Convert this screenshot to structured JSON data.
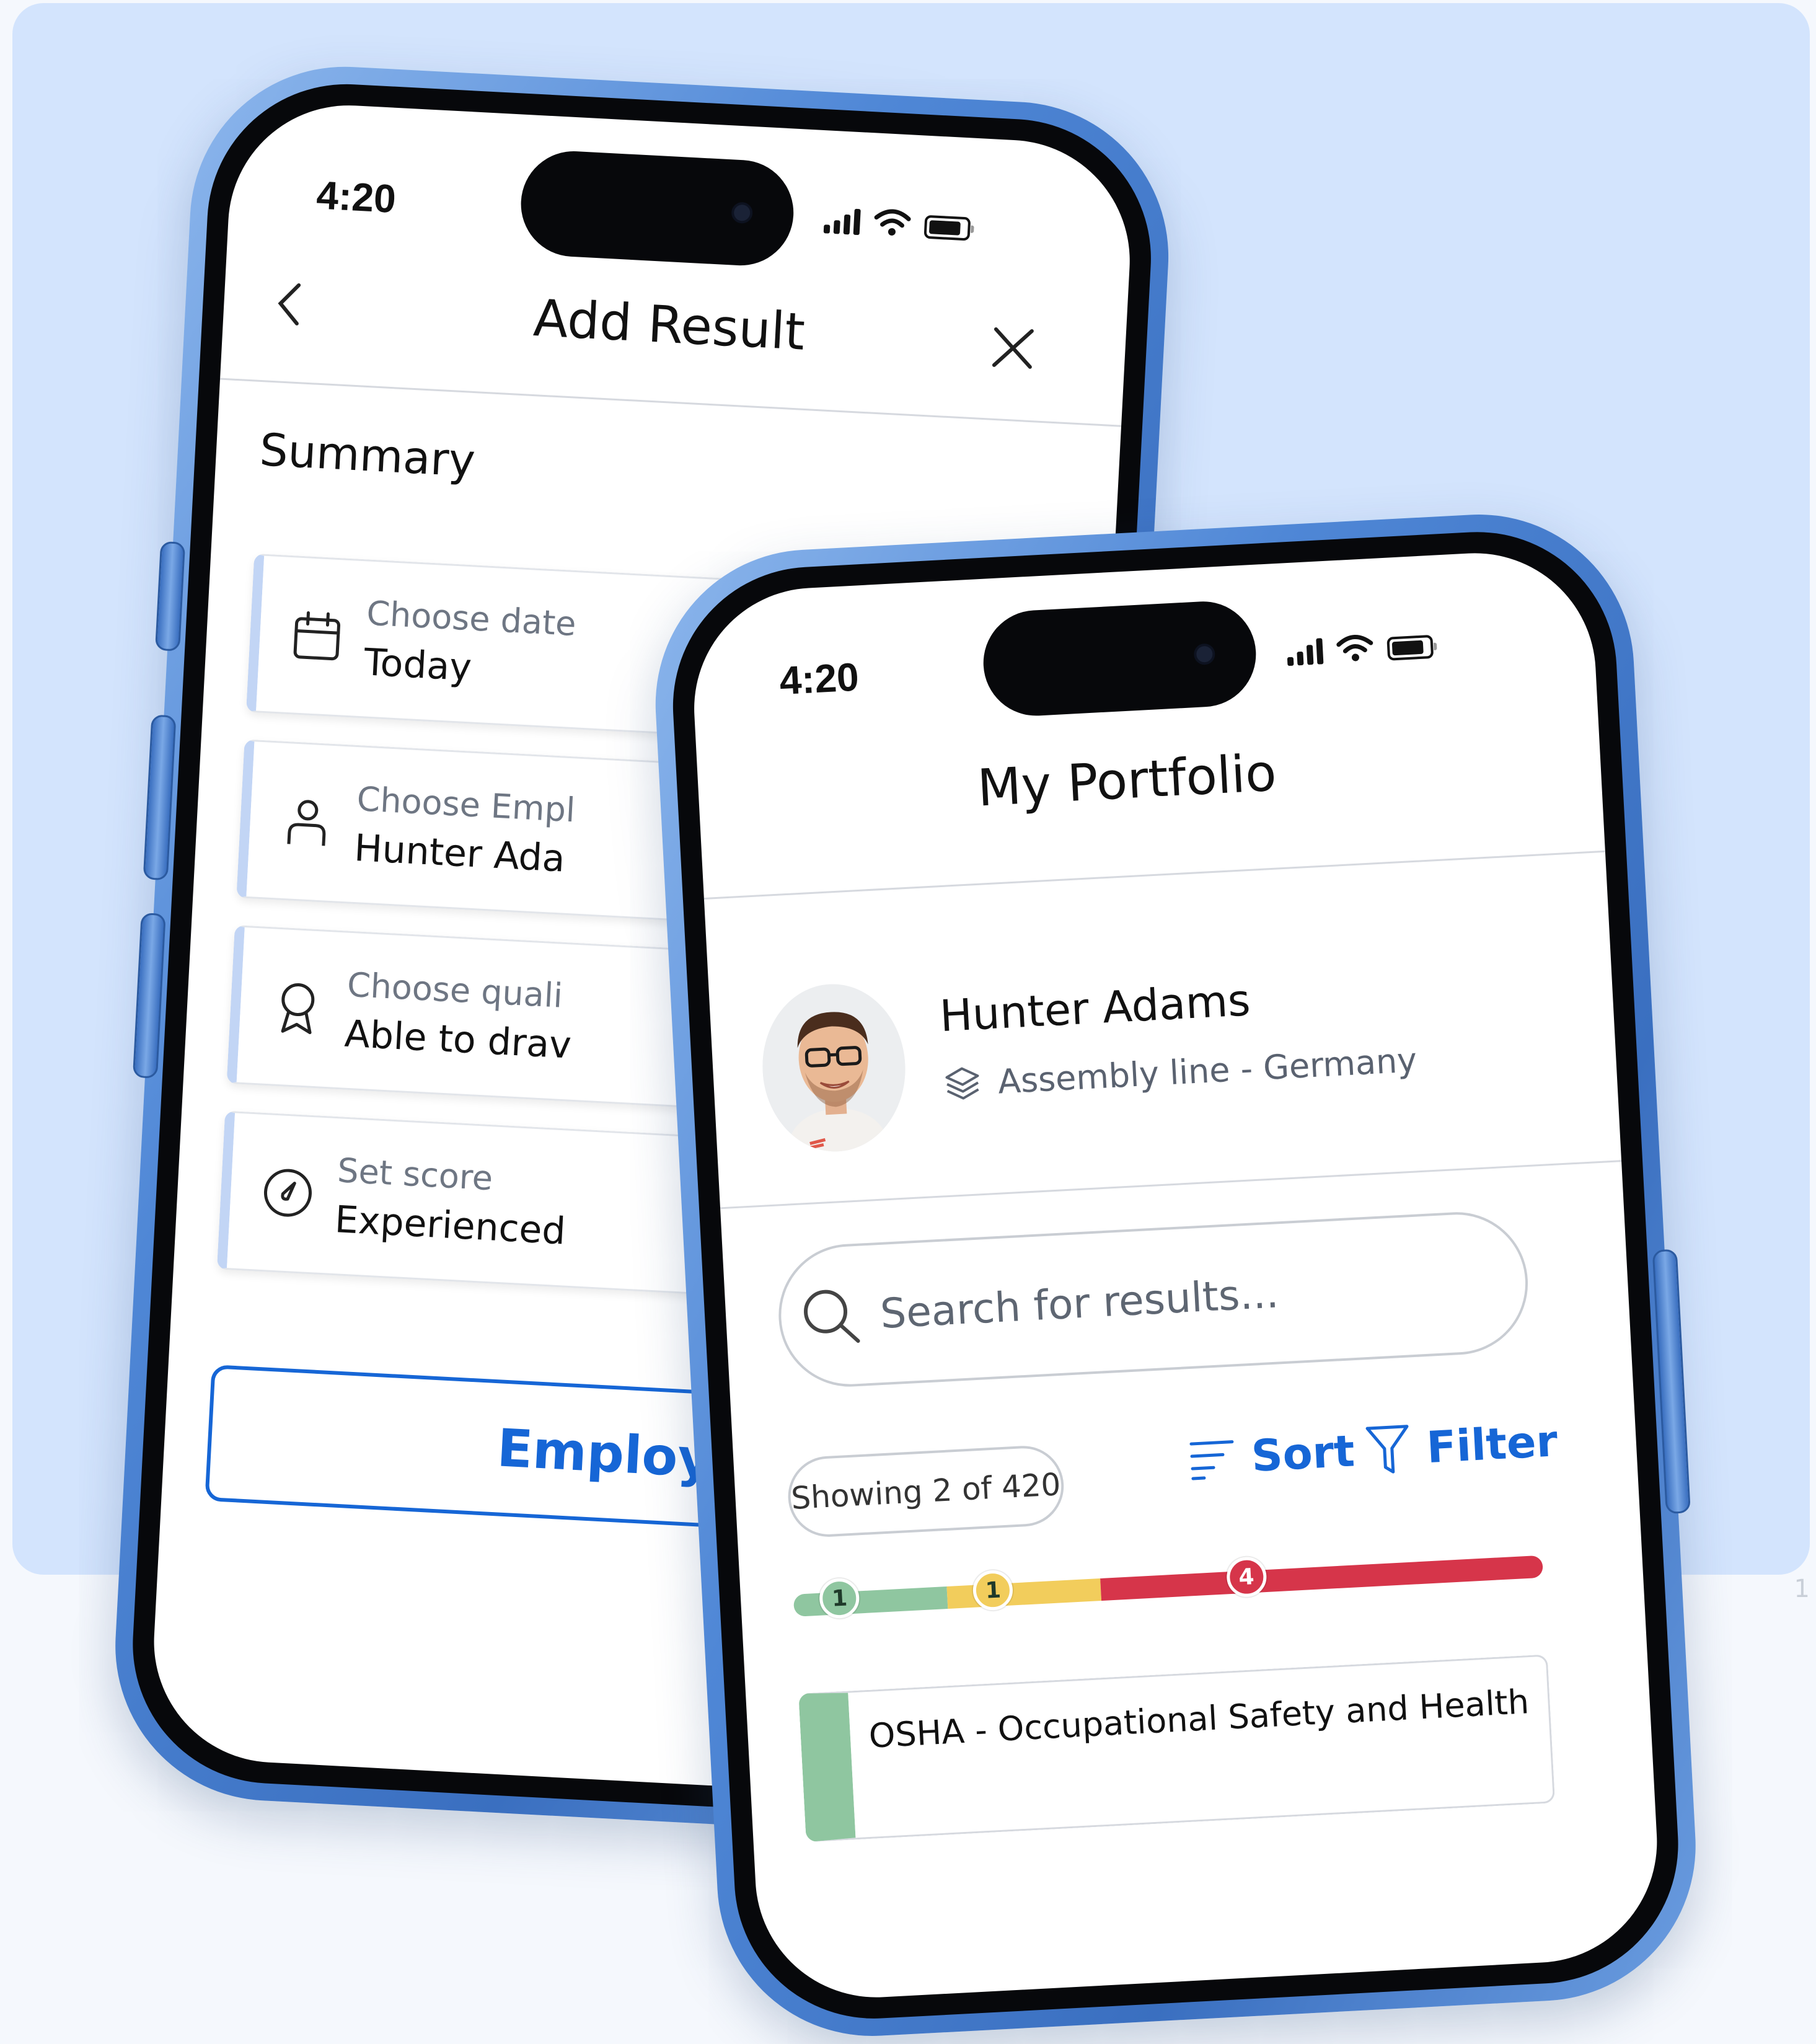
{
  "colors": {
    "accent": "#1666d6",
    "background": "#d3e4fd",
    "green": "#8fc6a0",
    "yellow": "#f2cd5c",
    "red": "#d6354a"
  },
  "back_phone": {
    "status": {
      "time": "4:20"
    },
    "header": {
      "title": "Add Result",
      "back_icon": "chevron-left-icon",
      "close_icon": "close-icon"
    },
    "summary_title": "Summary",
    "fields": [
      {
        "icon": "calendar-icon",
        "label": "Choose date",
        "value": "Today"
      },
      {
        "icon": "person-icon",
        "label": "Choose Empl",
        "value": "Hunter Ada"
      },
      {
        "icon": "award-icon",
        "label": "Choose quali",
        "value": "Able to drav"
      },
      {
        "icon": "gauge-icon",
        "label": "Set score",
        "value": "Experienced"
      }
    ],
    "cta_label": "Employ"
  },
  "front_phone": {
    "status": {
      "time": "4:20"
    },
    "header": {
      "title": "My Portfolio"
    },
    "profile": {
      "name": "Hunter Adams",
      "location": "Assembly line - Germany",
      "location_icon": "layers-icon"
    },
    "search": {
      "placeholder": "Search for results..."
    },
    "results_count": "Showing 2 of 420",
    "sort_label": "Sort",
    "filter_label": "Filter",
    "progress": {
      "segments": [
        {
          "color": "green",
          "marker": "1",
          "fraction": 0.205
        },
        {
          "color": "yellow",
          "marker": "1",
          "fraction": 0.205
        },
        {
          "color": "red",
          "marker": "4",
          "fraction": 0.59
        }
      ]
    },
    "result_item": {
      "title": "OSHA - Occupational Safety and Health"
    }
  },
  "page_number": "1"
}
